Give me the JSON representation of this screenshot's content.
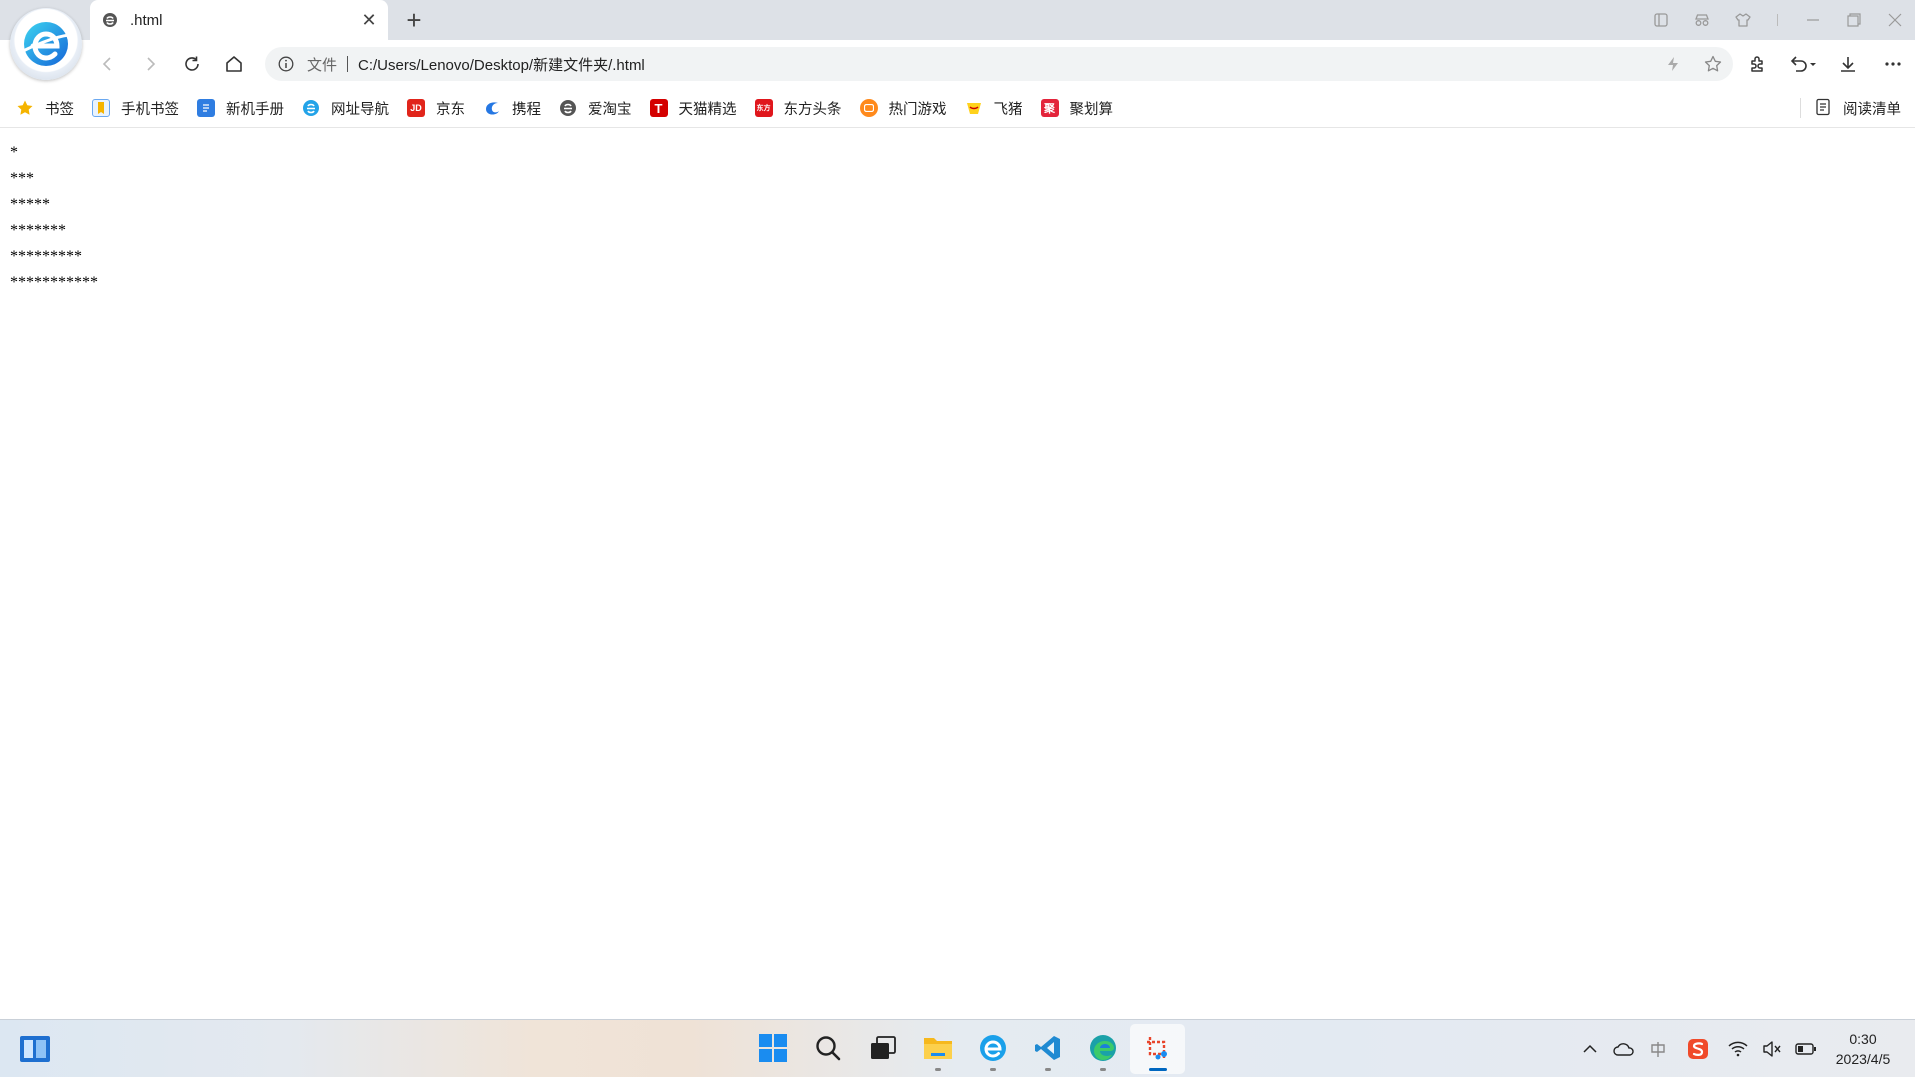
{
  "colors": {
    "accent": "#0067c0",
    "tab_strip_bg": "#dde1e7",
    "omnibox_bg": "#f1f3f4"
  },
  "tab": {
    "title": ".html",
    "icon": "browser-e-icon"
  },
  "address_bar": {
    "scheme_label": "文件",
    "url": "C:/Users/Lenovo/Desktop/新建文件夹/.html"
  },
  "bookmarks": [
    {
      "label": "书签",
      "icon": "star-icon"
    },
    {
      "label": "手机书签",
      "icon": "phone-bookmark-icon"
    },
    {
      "label": "新机手册",
      "icon": "manual-icon"
    },
    {
      "label": "网址导航",
      "icon": "browser-e-icon"
    },
    {
      "label": "京东",
      "icon": "jd-icon"
    },
    {
      "label": "携程",
      "icon": "ctrip-icon"
    },
    {
      "label": "爱淘宝",
      "icon": "aitaobao-icon"
    },
    {
      "label": "天猫精选",
      "icon": "tmall-icon"
    },
    {
      "label": "东方头条",
      "icon": "dongfang-icon"
    },
    {
      "label": "热门游戏",
      "icon": "games-icon"
    },
    {
      "label": "飞猪",
      "icon": "fliggy-icon"
    },
    {
      "label": "聚划算",
      "icon": "juhuasuan-icon"
    }
  ],
  "reading_list": {
    "label": "阅读清单",
    "icon": "reading-list-icon"
  },
  "page": {
    "lines": [
      "*",
      "***",
      "*****",
      "*******",
      "*********",
      "***********"
    ]
  },
  "taskbar": {
    "apps": [
      "start-icon",
      "search-icon",
      "task-view-icon",
      "file-explorer-icon",
      "browser-e-icon",
      "vscode-icon",
      "edge-icon",
      "snipping-tool-icon"
    ],
    "clock": {
      "time": "0:30",
      "date": "2023/4/5"
    }
  }
}
